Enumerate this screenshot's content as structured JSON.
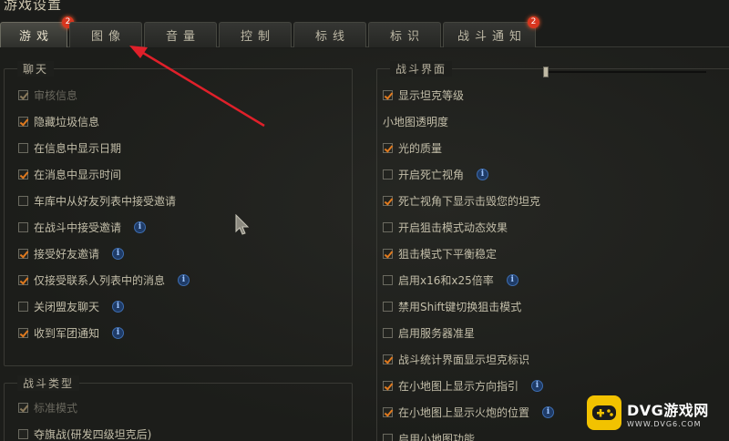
{
  "window": {
    "title": "游戏设置"
  },
  "tabs": [
    {
      "label": "游戏",
      "badge": "2",
      "active": true
    },
    {
      "label": "图像",
      "badge": "",
      "active": false
    },
    {
      "label": "音量",
      "badge": "",
      "active": false
    },
    {
      "label": "控制",
      "badge": "",
      "active": false
    },
    {
      "label": "标线",
      "badge": "",
      "active": false
    },
    {
      "label": "标识",
      "badge": "",
      "active": false
    },
    {
      "label": "战斗通知",
      "badge": "2",
      "active": false
    }
  ],
  "chat": {
    "title": "聊天",
    "items": [
      {
        "label": "审核信息",
        "checked": true,
        "disabled": true,
        "info": false
      },
      {
        "label": "隐藏垃圾信息",
        "checked": true,
        "disabled": false,
        "info": false
      },
      {
        "label": "在信息中显示日期",
        "checked": false,
        "disabled": false,
        "info": false
      },
      {
        "label": "在消息中显示时间",
        "checked": true,
        "disabled": false,
        "info": false
      },
      {
        "label": "车库中从好友列表中接受邀请",
        "checked": false,
        "disabled": false,
        "info": false
      },
      {
        "label": "在战斗中接受邀请",
        "checked": false,
        "disabled": false,
        "info": true
      },
      {
        "label": "接受好友邀请",
        "checked": true,
        "disabled": false,
        "info": true
      },
      {
        "label": "仅接受联系人列表中的消息",
        "checked": true,
        "disabled": false,
        "info": true
      },
      {
        "label": "关闭盟友聊天",
        "checked": false,
        "disabled": false,
        "info": true
      },
      {
        "label": "收到军团通知",
        "checked": true,
        "disabled": false,
        "info": true
      }
    ]
  },
  "battle_type": {
    "title": "战斗类型",
    "items": [
      {
        "label": "标准模式",
        "checked": true,
        "disabled": true,
        "info": false
      },
      {
        "label": "夺旗战(研发四级坦克后)",
        "checked": false,
        "disabled": false,
        "info": false
      }
    ]
  },
  "battle_ui": {
    "title": "战斗界面",
    "items": [
      {
        "label": "显示坦克等级",
        "checked": true,
        "info": false,
        "type": "checkbox"
      },
      {
        "label": "小地图透明度",
        "type": "slider",
        "value": 0.0
      },
      {
        "label": "光的质量",
        "checked": true,
        "info": false,
        "type": "checkbox"
      },
      {
        "label": "开启死亡视角",
        "checked": false,
        "info": true,
        "type": "checkbox"
      },
      {
        "label": "死亡视角下显示击毁您的坦克",
        "checked": true,
        "info": false,
        "type": "checkbox"
      },
      {
        "label": "开启狙击模式动态效果",
        "checked": false,
        "info": false,
        "type": "checkbox"
      },
      {
        "label": "狙击模式下平衡稳定",
        "checked": true,
        "info": false,
        "type": "checkbox"
      },
      {
        "label": "启用x16和x25倍率",
        "checked": false,
        "info": true,
        "type": "checkbox"
      },
      {
        "label": "禁用Shift键切换狙击模式",
        "checked": false,
        "info": false,
        "type": "checkbox"
      },
      {
        "label": "启用服务器准星",
        "checked": false,
        "info": false,
        "type": "checkbox"
      },
      {
        "label": "战斗统计界面显示坦克标识",
        "checked": true,
        "info": false,
        "type": "checkbox"
      },
      {
        "label": "在小地图上显示方向指引",
        "checked": true,
        "info": true,
        "type": "checkbox"
      },
      {
        "label": "在小地图上显示火炮的位置",
        "checked": true,
        "info": true,
        "type": "checkbox"
      },
      {
        "label": "启用小地图功能",
        "checked": false,
        "info": false,
        "type": "checkbox"
      }
    ]
  },
  "icons": {
    "info": "i",
    "checkbox": "checkmark-icon"
  },
  "colors": {
    "accent": "#e07a1f",
    "badge": "#d8361f",
    "arrow": "#e0202a",
    "info": "#3d6db0"
  },
  "watermark": {
    "main": "DVG游戏网",
    "sub": "WWW.DVG6.COM"
  }
}
